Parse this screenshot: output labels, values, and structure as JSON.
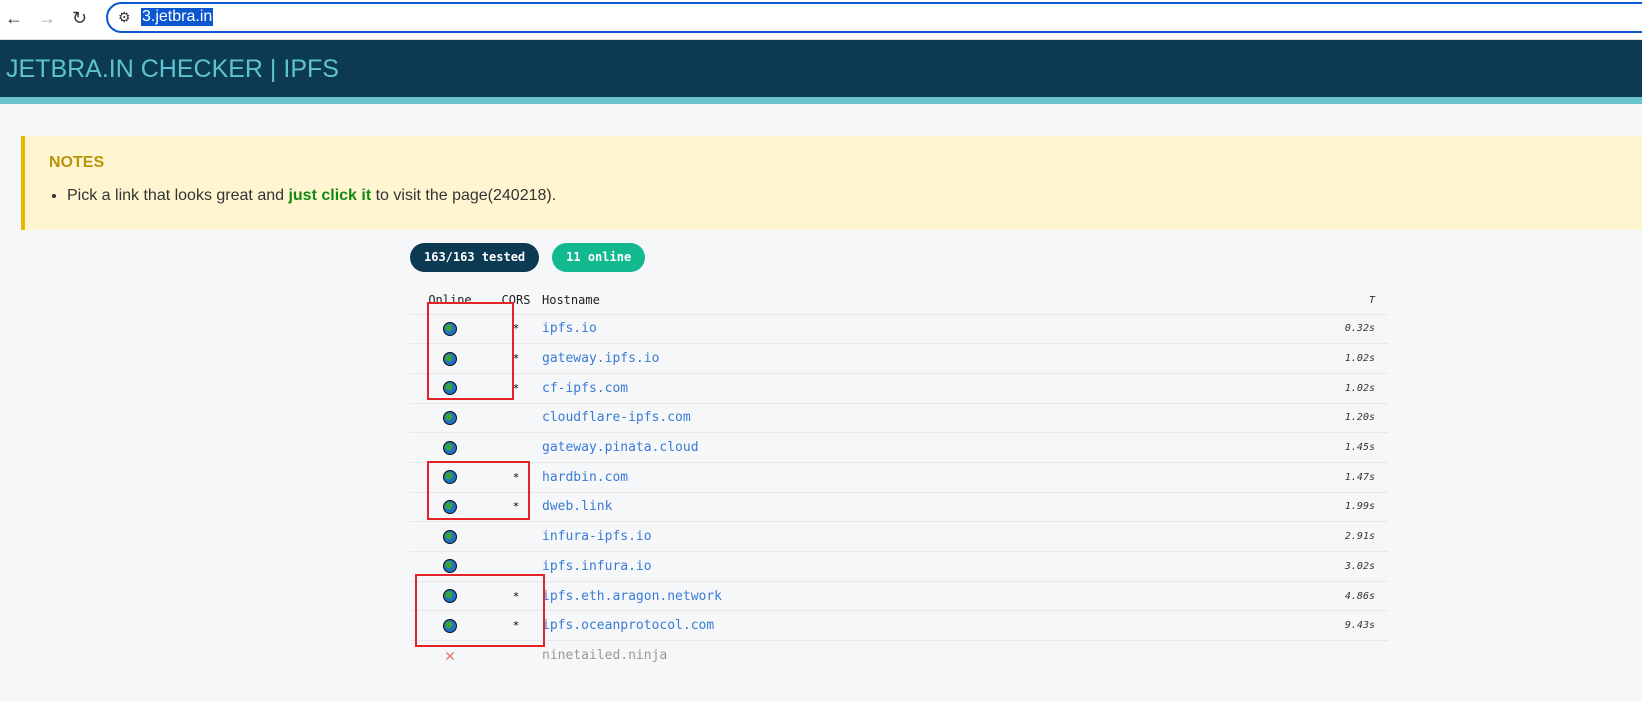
{
  "browser": {
    "url": "3.jetbra.in"
  },
  "header": {
    "title": "JETBRA.IN CHECKER | IPFS"
  },
  "notes": {
    "title": "NOTES",
    "pre": "Pick a link that looks great and ",
    "emph": "just click it",
    "post": " to visit the page(240218)."
  },
  "badges": {
    "tested": "163/163 tested",
    "online": "11 online",
    "tested_color": "#0b3a52",
    "online_color": "#12b88e"
  },
  "table": {
    "headers": {
      "online": "Online",
      "cors": "CORS",
      "hostname": "Hostname",
      "time": "T"
    },
    "rows": [
      {
        "online": true,
        "cors": "*",
        "host": "ipfs.io",
        "time": "0.32s"
      },
      {
        "online": true,
        "cors": "*",
        "host": "gateway.ipfs.io",
        "time": "1.02s"
      },
      {
        "online": true,
        "cors": "*",
        "host": "cf-ipfs.com",
        "time": "1.02s"
      },
      {
        "online": true,
        "cors": "",
        "host": "cloudflare-ipfs.com",
        "time": "1.20s"
      },
      {
        "online": true,
        "cors": "",
        "host": "gateway.pinata.cloud",
        "time": "1.45s"
      },
      {
        "online": true,
        "cors": "*",
        "host": "hardbin.com",
        "time": "1.47s"
      },
      {
        "online": true,
        "cors": "*",
        "host": "dweb.link",
        "time": "1.99s"
      },
      {
        "online": true,
        "cors": "",
        "host": "infura-ipfs.io",
        "time": "2.91s"
      },
      {
        "online": true,
        "cors": "",
        "host": "ipfs.infura.io",
        "time": "3.02s"
      },
      {
        "online": true,
        "cors": "*",
        "host": "ipfs.eth.aragon.network",
        "time": "4.86s"
      },
      {
        "online": true,
        "cors": "*",
        "host": "ipfs.oceanprotocol.com",
        "time": "9.43s"
      },
      {
        "online": false,
        "cors": "",
        "host": "ninetailed.ninja",
        "time": ""
      }
    ]
  }
}
